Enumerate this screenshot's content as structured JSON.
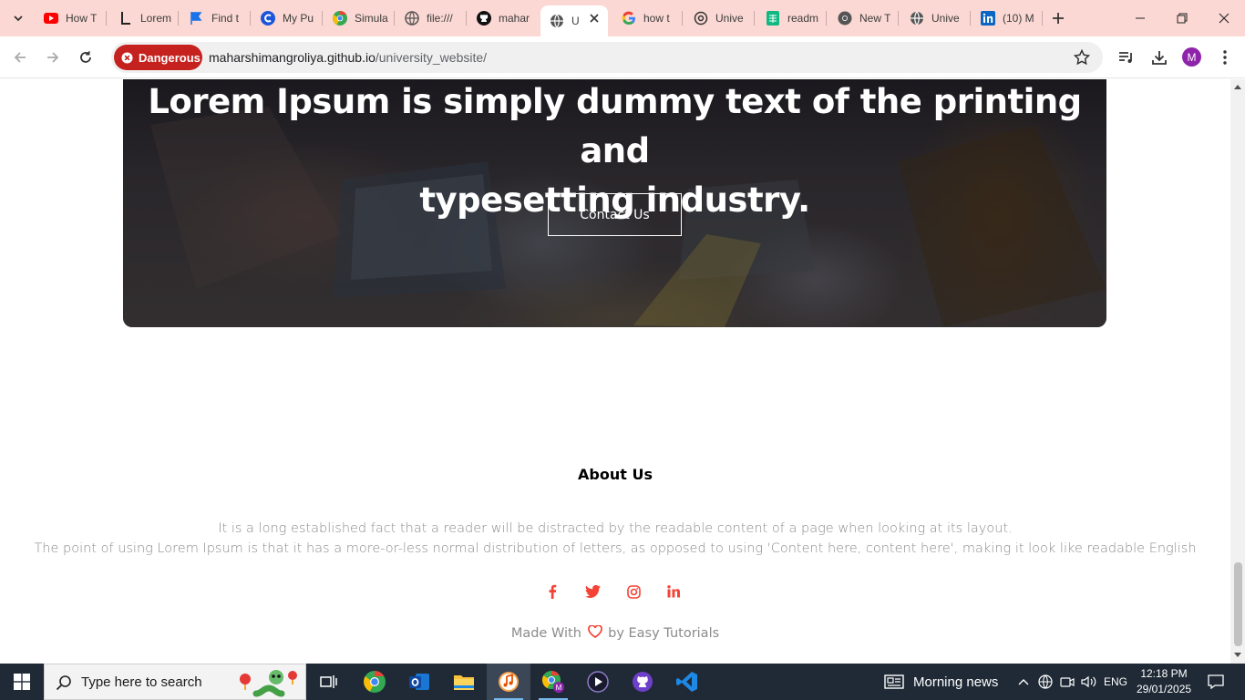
{
  "browser": {
    "tabs": [
      {
        "title": "How T",
        "icon": "youtube-icon"
      },
      {
        "title": "Lorem",
        "icon": "lorem-ipsum-icon"
      },
      {
        "title": "Find t",
        "icon": "flag-icon"
      },
      {
        "title": "My Pu",
        "icon": "c-icon"
      },
      {
        "title": "Simula",
        "icon": "chrome-icon"
      },
      {
        "title": "file:///",
        "icon": "globe-icon"
      },
      {
        "title": "mahar",
        "icon": "github-icon"
      },
      {
        "title": "U",
        "icon": "globe-icon",
        "active": true
      },
      {
        "title": "how t",
        "icon": "google-icon"
      },
      {
        "title": "Unive",
        "icon": "chatgpt-icon"
      },
      {
        "title": "readm",
        "icon": "sheet-icon"
      },
      {
        "title": "New T",
        "icon": "chrome-icon"
      },
      {
        "title": "Unive",
        "icon": "globe-icon"
      },
      {
        "title": "(10) M",
        "icon": "linkedin-icon"
      }
    ],
    "security_chip": "Dangerous",
    "url_host": "maharshimangroliya.github.io",
    "url_path": "/university_website/",
    "profile_initial": "M"
  },
  "page": {
    "cta_heading_line1": "Lorem Ipsum is simply dummy text of the printing and",
    "cta_heading_line2": "typesetting industry.",
    "cta_button": "Contact Us",
    "about_title": "About Us",
    "about_line1": "It is a long established fact that a reader will be distracted by the readable content of a page when looking at its layout.",
    "about_line2": "The point of using Lorem Ipsum is that it has a more-or-less normal distribution of letters, as opposed to using 'Content here, content here', making it look like readable English",
    "socials": [
      "facebook-icon",
      "twitter-icon",
      "instagram-icon",
      "linkedin-icon"
    ],
    "made_with_prefix": "Made With",
    "made_with_suffix": "by Easy Tutorials",
    "accent_color": "#f44336"
  },
  "taskbar": {
    "search_placeholder": "Type here to search",
    "apps": [
      "task-view-icon",
      "chrome-icon",
      "outlook-icon",
      "file-explorer-icon",
      "music-player-icon",
      "chrome-profile-icon",
      "media-player-icon",
      "github-desktop-icon",
      "vscode-icon"
    ],
    "news": "Morning news",
    "language": "ENG",
    "time": "12:18 PM",
    "date": "29/01/2025"
  }
}
